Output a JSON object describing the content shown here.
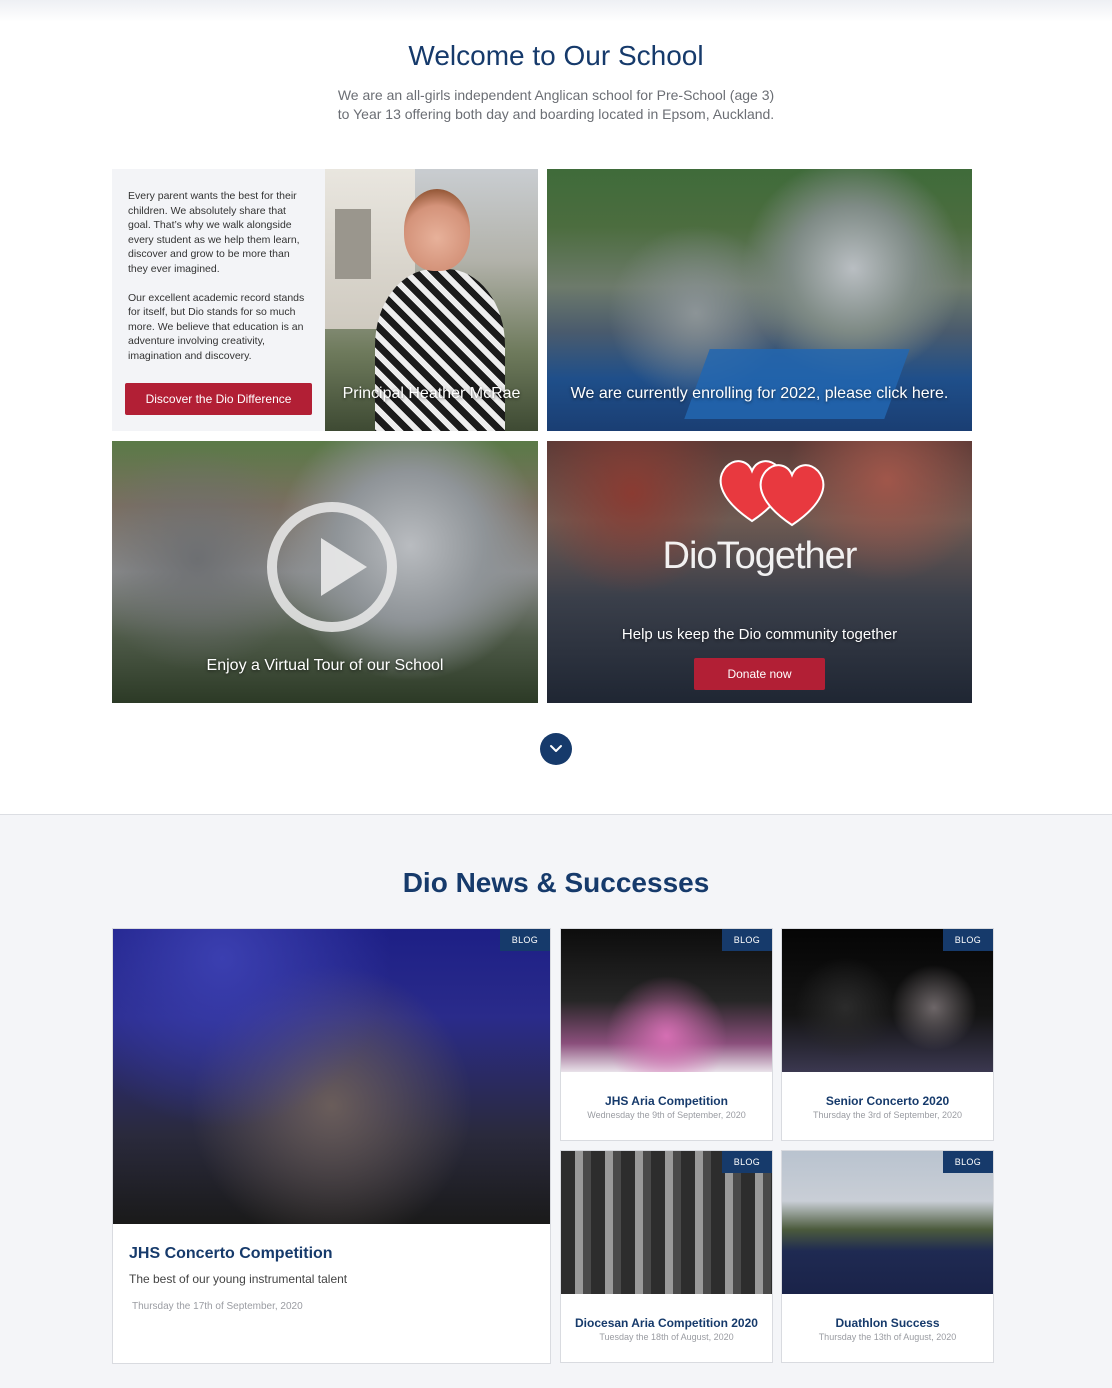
{
  "welcome": {
    "title": "Welcome to Our School",
    "intro_line1": "We are an all-girls independent Anglican school for Pre-School (age 3)",
    "intro_line2": "to Year 13 offering both day and boarding located in Epsom, Auckland."
  },
  "intro_box": {
    "para1": "Every parent wants the best for their children. We absolutely share that goal. That’s why we walk alongside every student as we help them learn, discover and grow to be more than they ever imagined.",
    "para2": "Our excellent academic record stands for itself, but Dio stands for so much more. We believe that education is an adventure involving creativity, imagination and discovery.",
    "button": "Discover the Dio Difference"
  },
  "tiles": {
    "principal": "Principal Heather McRae",
    "enrol": "We are currently enrolling for 2022, please click here.",
    "tour": "Enjoy a Virtual Tour of our School",
    "together_brand": "DioTogether",
    "together_caption": "Help us keep the Dio community together",
    "donate": "Donate now"
  },
  "news": {
    "title": "Dio News & Successes",
    "badge": "BLOG",
    "featured": {
      "title": "JHS Concerto Competition",
      "subtitle": "The best of our young instrumental talent",
      "date": "Thursday the 17th of September, 2020"
    },
    "items": [
      {
        "title": "JHS Aria Competition",
        "date": "Wednesday the 9th of September, 2020"
      },
      {
        "title": "Senior Concerto 2020",
        "date": "Thursday the 3rd of September, 2020"
      },
      {
        "title": "Diocesan Aria Competition 2020",
        "date": "Tuesday the 18th of August, 2020"
      },
      {
        "title": "Duathlon Success",
        "date": "Thursday the 13th of August, 2020"
      }
    ]
  },
  "colors": {
    "navy": "#163a6b",
    "red": "#b21f35",
    "section_bg": "#f4f5f8"
  },
  "icons": [
    "play-icon",
    "chevron-down-icon",
    "hearts-icon"
  ]
}
